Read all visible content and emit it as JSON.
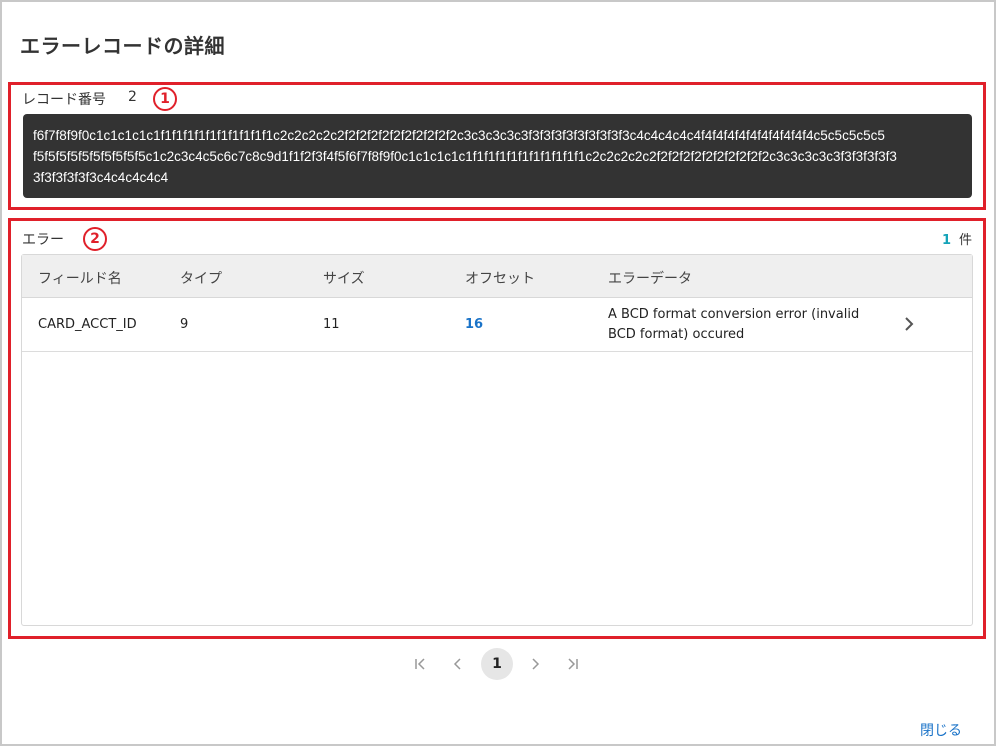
{
  "dialog": {
    "title": "エラーレコードの詳細",
    "close_label": "閉じる"
  },
  "record": {
    "label": "レコード番号",
    "number": "2",
    "annotation": "1",
    "hex_lines": [
      "f6f7f8f9f0c1c1c1c1c1f1f1f1f1f1f1f1f1f1f1c2c2c2c2c2f2f2f2f2f2f2f2f2f2f2c3c3c3c3c3f3f3f3f3f3f3f3f3f3c4c4c4c4c4f4f4f4f4f4f4f4f4f4f4c5c5c5c5c5",
      "f5f5f5f5f5f5f5f5f5f5c1c2c3c4c5c6c7c8c9d1f1f2f3f4f5f6f7f8f9f0c1c1c1c1c1f1f1f1f1f1f1f1f1f1f1c2c2c2c2c2f2f2f2f2f2f2f2f2f2f2c3c3c3c3c3f3f3f3f3f3",
      "3f3f3f3f3f3c4c4c4c4c4"
    ]
  },
  "errors": {
    "label": "エラー",
    "annotation": "2",
    "count": "1",
    "count_unit": "件",
    "columns": [
      "フィールド名",
      "タイプ",
      "サイズ",
      "オフセット",
      "エラーデータ"
    ],
    "rows": [
      {
        "field": "CARD_ACCT_ID",
        "type": "9",
        "size": "11",
        "offset": "16",
        "error_line1": "A BCD format conversion error (invalid",
        "error_line2": "BCD format) occured"
      }
    ]
  },
  "pagination": {
    "current": "1",
    "first_icon": "first-page-icon",
    "prev_icon": "chevron-left-icon",
    "next_icon": "chevron-right-icon",
    "last_icon": "last-page-icon"
  },
  "colors": {
    "annotation": "#e0202a",
    "link": "#1a73c8",
    "count": "#14a3b8",
    "hex_bg": "#333333"
  }
}
